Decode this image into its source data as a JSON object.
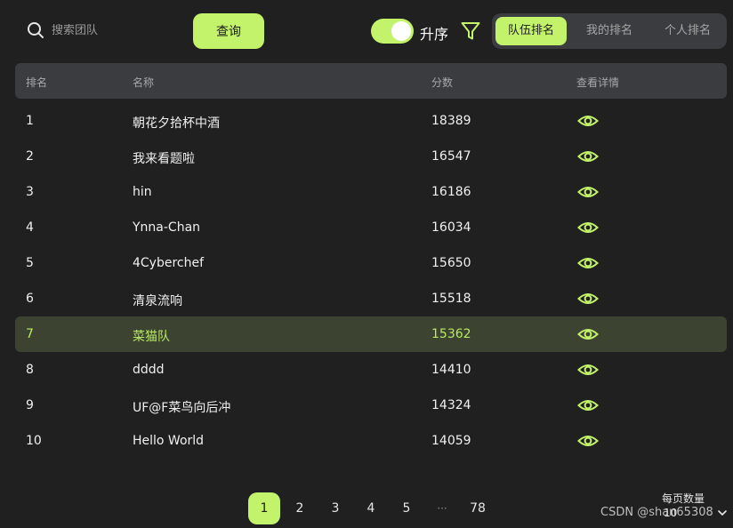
{
  "search": {
    "placeholder": "搜索团队"
  },
  "toolbar": {
    "query_label": "查询",
    "sort_label": "升序",
    "ascending_on": true
  },
  "tabs": [
    {
      "label": "队伍排名",
      "active": true
    },
    {
      "label": "我的排名",
      "active": false
    },
    {
      "label": "个人排名",
      "active": false
    }
  ],
  "table": {
    "headers": [
      "排名",
      "名称",
      "分数",
      "查看详情"
    ],
    "rows": [
      {
        "rank": "1",
        "name": "朝花夕拾杯中酒",
        "score": "18389"
      },
      {
        "rank": "2",
        "name": "我来看题啦",
        "score": "16547"
      },
      {
        "rank": "3",
        "name": "hin",
        "score": "16186"
      },
      {
        "rank": "4",
        "name": "Ynna-Chan",
        "score": "16034"
      },
      {
        "rank": "5",
        "name": "4Cyberchef",
        "score": "15650"
      },
      {
        "rank": "6",
        "name": "清泉流响",
        "score": "15518"
      },
      {
        "rank": "7",
        "name": "菜猫队",
        "score": "15362",
        "highlighted": true
      },
      {
        "rank": "8",
        "name": "dddd",
        "score": "14410"
      },
      {
        "rank": "9",
        "name": "UF@F菜鸟向后冲",
        "score": "14324"
      },
      {
        "rank": "10",
        "name": "Hello World",
        "score": "14059"
      }
    ]
  },
  "pagination": {
    "pages": [
      "1",
      "2",
      "3",
      "4",
      "5",
      "···",
      "78"
    ],
    "current": "1",
    "per_page_label": "每页数量",
    "per_page_value": "10"
  },
  "watermark": "CSDN @shan65308",
  "colors": {
    "accent": "#c3f26b",
    "background": "#202020",
    "header_bg": "#3b3c40",
    "highlight_row_bg": "#3c4330",
    "highlight_text": "#b9ea62"
  },
  "icons": {
    "search": "search-icon",
    "filter": "filter-icon",
    "view": "eye-icon",
    "per_page_dropdown": "chevron-down-icon"
  }
}
